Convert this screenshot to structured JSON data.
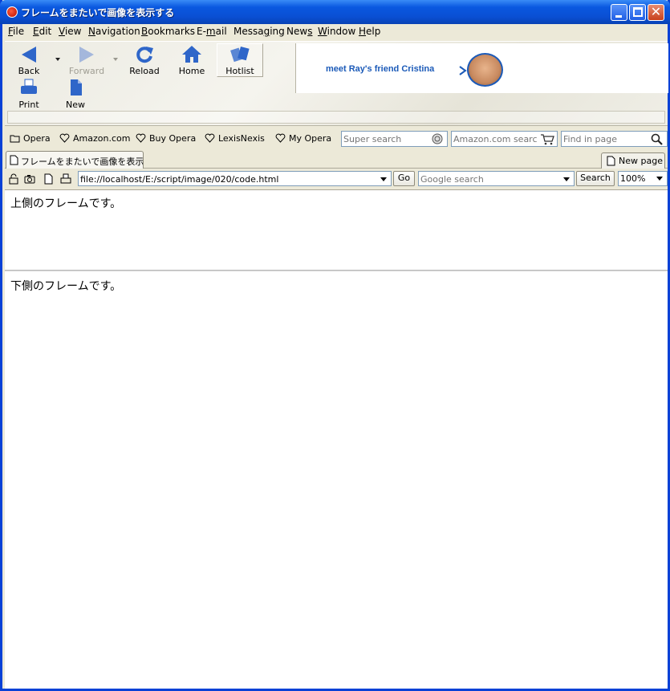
{
  "window": {
    "title": "フレームをまたいで画像を表示する"
  },
  "menu": [
    {
      "pre": "",
      "u": "F",
      "post": "ile"
    },
    {
      "pre": "",
      "u": "E",
      "post": "dit"
    },
    {
      "pre": "",
      "u": "V",
      "post": "iew"
    },
    {
      "pre": "",
      "u": "N",
      "post": "avigation"
    },
    {
      "pre": "",
      "u": "B",
      "post": "ookmarks"
    },
    {
      "pre": "E-",
      "u": "m",
      "post": "ail"
    },
    {
      "pre": "Messa",
      "u": "g",
      "post": "ing"
    },
    {
      "pre": "New",
      "u": "s",
      "post": ""
    },
    {
      "pre": "",
      "u": "W",
      "post": "indow"
    },
    {
      "pre": "",
      "u": "H",
      "post": "elp"
    }
  ],
  "toolbar": {
    "back": "Back",
    "forward": "Forward",
    "reload": "Reload",
    "home": "Home",
    "hotlist": "Hotlist",
    "print": "Print",
    "new": "New"
  },
  "banner": {
    "text": "meet Ray's friend Cristina"
  },
  "personal_bar": {
    "items": [
      "Opera",
      "Amazon.com",
      "Buy Opera",
      "LexisNexis",
      "My Opera"
    ],
    "super_search_placeholder": "Super search",
    "amazon_search_placeholder": "Amazon.com search",
    "find_placeholder": "Find in page"
  },
  "tabs": {
    "active_tab": "フレームをまたいで画像を表示...",
    "new_page": "New page"
  },
  "address_bar": {
    "url": "file://localhost/E:/script/image/020/code.html",
    "go": "Go",
    "google_placeholder": "Google search",
    "search": "Search",
    "zoom": "100%"
  },
  "frames": {
    "top_text": "上側のフレームです。",
    "bottom_text": "下側のフレームです。"
  },
  "colors": {
    "title_blue": "#0a4fd3",
    "icon_blue": "#2f66c9",
    "banner_blue": "#1b5ab8"
  }
}
